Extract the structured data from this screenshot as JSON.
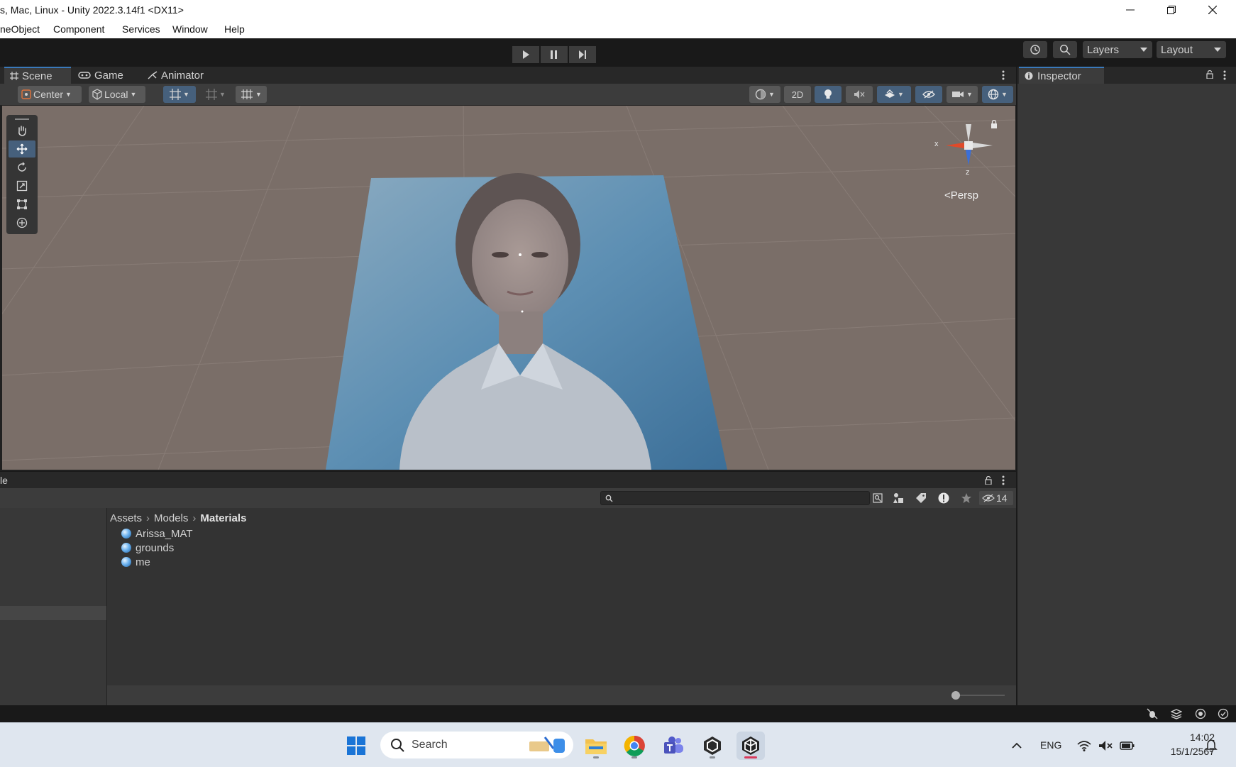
{
  "window": {
    "title": "s, Mac, Linux - Unity 2022.3.14f1 <DX11>"
  },
  "menu": [
    "neObject",
    "Component",
    "Services",
    "Window",
    "Help"
  ],
  "toolbar": {
    "layers_label": "Layers",
    "layout_label": "Layout"
  },
  "scene_tabs": [
    {
      "label": "Scene",
      "icon": "grid-icon"
    },
    {
      "label": "Game",
      "icon": "gamepad-icon"
    },
    {
      "label": "Animator",
      "icon": "animator-icon"
    }
  ],
  "scene_toolbar": {
    "pivot_mode": "Center",
    "pivot_rotation": "Local",
    "mode_2d": "2D"
  },
  "scene_view": {
    "gizmo_x": "x",
    "gizmo_z": "z",
    "projection": "Persp"
  },
  "inspector": {
    "title": "Inspector"
  },
  "project": {
    "panel_title_fragment": "le",
    "hidden_count": "14",
    "breadcrumb": [
      "Assets",
      "Models",
      "Materials"
    ],
    "assets": [
      "Arissa_MAT",
      "grounds",
      "me"
    ]
  },
  "taskbar": {
    "search_placeholder": "Search",
    "language": "ENG",
    "time": "14:02",
    "date": "15/1/2567"
  },
  "colors": {
    "accent": "#3a79bb",
    "scene_ground": "#7a6e68",
    "panel_bg": "#383838"
  }
}
